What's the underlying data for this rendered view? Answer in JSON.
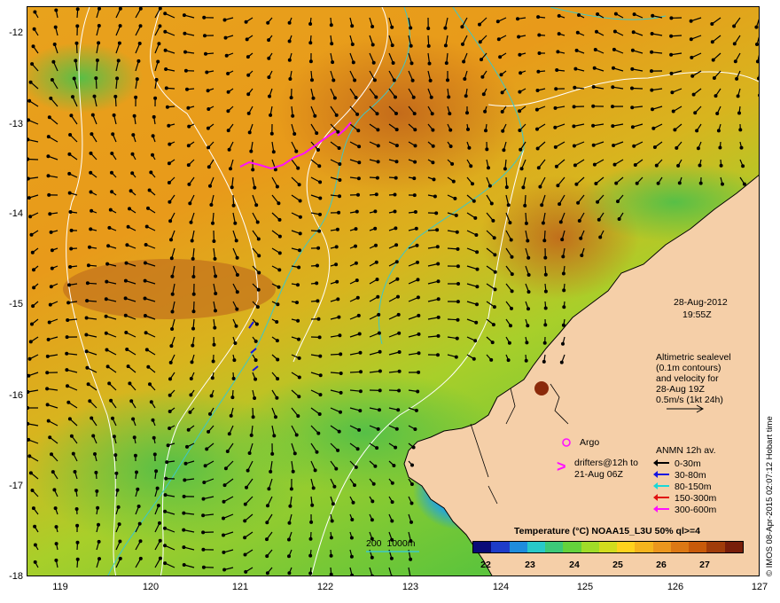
{
  "latitudes": [
    "-12",
    "-13",
    "-14",
    "-15",
    "-16",
    "-17",
    "-18"
  ],
  "longitudes": [
    "119",
    "120",
    "121",
    "122",
    "123",
    "124",
    "125",
    "126",
    "127"
  ],
  "date": "28-Aug-2012",
  "time": "19:55Z",
  "altimetry_note": [
    "Altimetric sealevel",
    "(0.1m contours)",
    "and velocity for",
    "28-Aug 19Z",
    "0.5m/s (1kt 24h)"
  ],
  "argo_label": "Argo",
  "drifters_label": [
    "drifters@12h to",
    "21-Aug 06Z"
  ],
  "drifters_symbol": ">",
  "anmn_title": "ANMN 12h av.",
  "anmn_legend": [
    {
      "label": "0-30m",
      "color": "#000000"
    },
    {
      "label": "30-80m",
      "color": "#1515e0"
    },
    {
      "label": "80-150m",
      "color": "#19d8d8"
    },
    {
      "label": "150-300m",
      "color": "#e01010"
    },
    {
      "label": "300-600m",
      "color": "#ff10ff"
    }
  ],
  "isobath_label": "200  1000m",
  "colorbar_title": "Temperature (°C) NOAA15_L3U 50% ql>=4",
  "colorbar_ticks": [
    "22",
    "23",
    "24",
    "25",
    "26",
    "27"
  ],
  "colorbar_colors": [
    "#0a0a78",
    "#1e3cc8",
    "#1e8cdc",
    "#28c8c8",
    "#3cc878",
    "#64d23c",
    "#a0dc28",
    "#d2dc1e",
    "#ffd21e",
    "#f5b41e",
    "#eb961e",
    "#dc7814",
    "#c85a0a",
    "#a03c0a",
    "#781e0a"
  ],
  "watermark": "© IMOS 08-Apr-2015 02:07:12 Hobart time"
}
